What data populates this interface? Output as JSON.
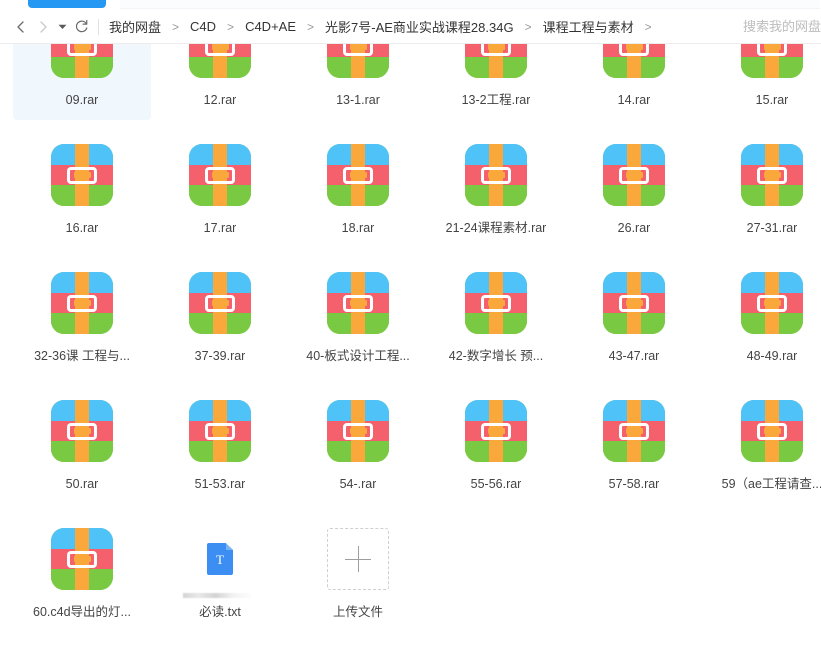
{
  "window": {
    "top_action_button_label": ""
  },
  "toolbar": {
    "back_label": "‹",
    "forward_label": "›",
    "history_caret_label": "▾",
    "refresh_label": "↻"
  },
  "breadcrumb": {
    "separator": ">",
    "items": [
      "我的网盘",
      "C4D",
      "C4D+AE",
      "光影7号-AE商业实战课程28.34G",
      "课程工程与素材"
    ],
    "trailing_separator": ">"
  },
  "search": {
    "placeholder": "搜索我的网盘",
    "value": ""
  },
  "colors": {
    "accent_blue": "#2598f4",
    "selection_bg": "#f0f7fd",
    "rar_blue": "#4fc3f7",
    "rar_red": "#f4606c",
    "rar_green": "#7ac943",
    "rar_orange": "#faa73c",
    "txt_blue": "#3c8ef3",
    "upload_border": "#cfcfcf"
  },
  "grid": {
    "columns": 6,
    "items": [
      {
        "label": "09.rar",
        "icon": "rar-archive-icon",
        "selected": true
      },
      {
        "label": "12.rar",
        "icon": "rar-archive-icon",
        "selected": false
      },
      {
        "label": "13-1.rar",
        "icon": "rar-archive-icon",
        "selected": false
      },
      {
        "label": "13-2工程.rar",
        "icon": "rar-archive-icon",
        "selected": false
      },
      {
        "label": "14.rar",
        "icon": "rar-archive-icon",
        "selected": false
      },
      {
        "label": "15.rar",
        "icon": "rar-archive-icon",
        "selected": false
      },
      {
        "label": "16.rar",
        "icon": "rar-archive-icon",
        "selected": false
      },
      {
        "label": "17.rar",
        "icon": "rar-archive-icon",
        "selected": false
      },
      {
        "label": "18.rar",
        "icon": "rar-archive-icon",
        "selected": false
      },
      {
        "label": "21-24课程素材.rar",
        "icon": "rar-archive-icon",
        "selected": false
      },
      {
        "label": "26.rar",
        "icon": "rar-archive-icon",
        "selected": false
      },
      {
        "label": "27-31.rar",
        "icon": "rar-archive-icon",
        "selected": false
      },
      {
        "label": "32-36课 工程与...",
        "icon": "rar-archive-icon",
        "selected": false
      },
      {
        "label": "37-39.rar",
        "icon": "rar-archive-icon",
        "selected": false
      },
      {
        "label": "40-板式设计工程...",
        "icon": "rar-archive-icon",
        "selected": false
      },
      {
        "label": "42-数字增长 预...",
        "icon": "rar-archive-icon",
        "selected": false
      },
      {
        "label": "43-47.rar",
        "icon": "rar-archive-icon",
        "selected": false
      },
      {
        "label": "48-49.rar",
        "icon": "rar-archive-icon",
        "selected": false
      },
      {
        "label": "50.rar",
        "icon": "rar-archive-icon",
        "selected": false
      },
      {
        "label": "51-53.rar",
        "icon": "rar-archive-icon",
        "selected": false
      },
      {
        "label": "54-.rar",
        "icon": "rar-archive-icon",
        "selected": false
      },
      {
        "label": "55-56.rar",
        "icon": "rar-archive-icon",
        "selected": false
      },
      {
        "label": "57-58.rar",
        "icon": "rar-archive-icon",
        "selected": false
      },
      {
        "label": "59（ae工程请查...",
        "icon": "rar-archive-icon",
        "selected": false
      },
      {
        "label": "60.c4d导出的灯...",
        "icon": "rar-archive-icon",
        "selected": false
      },
      {
        "label": "必读.txt",
        "icon": "txt-file-icon",
        "selected": false
      },
      {
        "label": "上传文件",
        "icon": "upload-plus-icon",
        "selected": false
      }
    ]
  }
}
